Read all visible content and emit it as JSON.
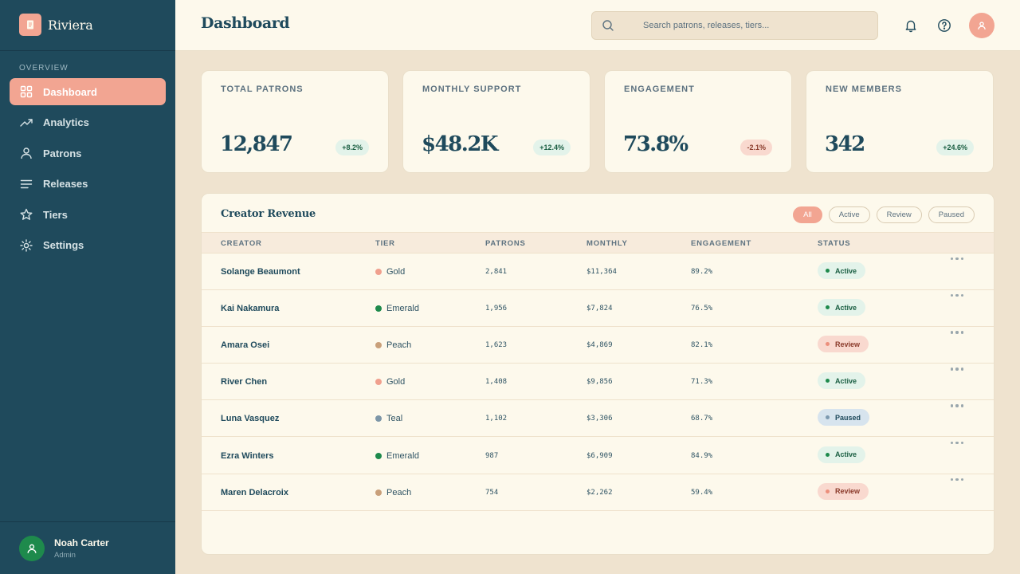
{
  "app": {
    "name": "Riviera"
  },
  "sidebar": {
    "section_label": "OVERVIEW",
    "items": [
      {
        "label": "Dashboard",
        "icon": "grid-icon",
        "active": true
      },
      {
        "label": "Analytics",
        "icon": "trend-icon",
        "active": false
      },
      {
        "label": "Patrons",
        "icon": "user-icon",
        "active": false
      },
      {
        "label": "Releases",
        "icon": "lines-icon",
        "active": false
      },
      {
        "label": "Tiers",
        "icon": "star-icon",
        "active": false
      },
      {
        "label": "Settings",
        "icon": "gear-icon",
        "active": false
      }
    ],
    "user": {
      "name": "Noah Carter",
      "role": "Admin"
    }
  },
  "header": {
    "title": "Dashboard",
    "search_placeholder": "Search patrons, releases, tiers..."
  },
  "stats": [
    {
      "label": "TOTAL PATRONS",
      "value": "12,847",
      "delta": "+8.2%",
      "trend": "up"
    },
    {
      "label": "MONTHLY SUPPORT",
      "value": "$48.2K",
      "delta": "+12.4%",
      "trend": "up"
    },
    {
      "label": "ENGAGEMENT",
      "value": "73.8%",
      "delta": "-2.1%",
      "trend": "down"
    },
    {
      "label": "NEW MEMBERS",
      "value": "342",
      "delta": "+24.6%",
      "trend": "up"
    }
  ],
  "table": {
    "title": "Creator Revenue",
    "filters": [
      "All",
      "Active",
      "Review",
      "Paused"
    ],
    "active_filter": "All",
    "columns": [
      "CREATOR",
      "TIER",
      "PATRONS",
      "MONTHLY",
      "ENGAGEMENT",
      "STATUS"
    ],
    "rows": [
      {
        "creator": "Solange Beaumont",
        "tier": "Gold",
        "tier_color": "#f0a08e",
        "patrons": "2,841",
        "monthly": "$11,364",
        "engagement": "89.2%",
        "status": "Active"
      },
      {
        "creator": "Kai Nakamura",
        "tier": "Emerald",
        "tier_color": "#1e8a4c",
        "patrons": "1,956",
        "monthly": "$7,824",
        "engagement": "76.5%",
        "status": "Active"
      },
      {
        "creator": "Amara Osei",
        "tier": "Peach",
        "tier_color": "#c9a07a",
        "patrons": "1,623",
        "monthly": "$4,869",
        "engagement": "82.1%",
        "status": "Review"
      },
      {
        "creator": "River Chen",
        "tier": "Gold",
        "tier_color": "#f0a08e",
        "patrons": "1,408",
        "monthly": "$9,856",
        "engagement": "71.3%",
        "status": "Active"
      },
      {
        "creator": "Luna Vasquez",
        "tier": "Teal",
        "tier_color": "#7d96a8",
        "patrons": "1,102",
        "monthly": "$3,306",
        "engagement": "68.7%",
        "status": "Paused"
      },
      {
        "creator": "Ezra Winters",
        "tier": "Emerald",
        "tier_color": "#1e8a4c",
        "patrons": "987",
        "monthly": "$6,909",
        "engagement": "84.9%",
        "status": "Active"
      },
      {
        "creator": "Maren Delacroix",
        "tier": "Peach",
        "tier_color": "#c9a07a",
        "patrons": "754",
        "monthly": "$2,262",
        "engagement": "59.4%",
        "status": "Review"
      }
    ]
  },
  "colors": {
    "sidebar": "#1f4a5c",
    "accent": "#f2a592",
    "surface": "#fdf9ec",
    "background": "#efe3cf"
  }
}
